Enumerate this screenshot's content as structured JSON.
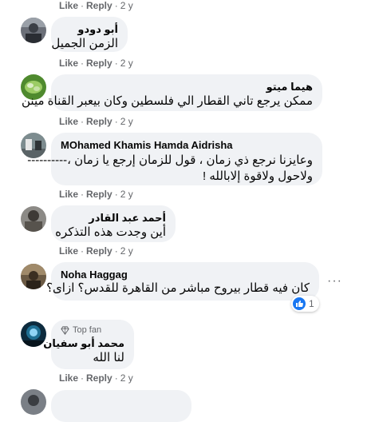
{
  "actions": {
    "like": "Like",
    "reply": "Reply",
    "age": "2 y"
  },
  "comments": [
    {
      "author": "أبو دودو",
      "text": [
        "الزمن الجميل"
      ]
    },
    {
      "author": "هيما ميتو",
      "text": [
        "ممكن يرجع تاني القطار الي فلسطين وكان بيعبر القناة مينن"
      ]
    },
    {
      "author": "MOhamed Khamis Hamda Aidrisha",
      "text": [
        "وعايزنا نرجع ذي زمان ، قول للزمان إرجع يا زمان ،----------",
        "ولاحول ولاقوة إلابالله !"
      ]
    },
    {
      "author": "أحمد عبد القادر",
      "text": [
        "أين وجدت هذه التذكره"
      ]
    },
    {
      "author": "Noha Haggag",
      "text": [
        "كان فيه قطار بيروح مباشر من القاهرة للقدس؟ ازاى؟"
      ],
      "reactions": "1"
    },
    {
      "badge": "Top fan",
      "author": "محمد أبو سفيان",
      "text": [
        "لنا الله"
      ]
    }
  ],
  "more_options": "···"
}
